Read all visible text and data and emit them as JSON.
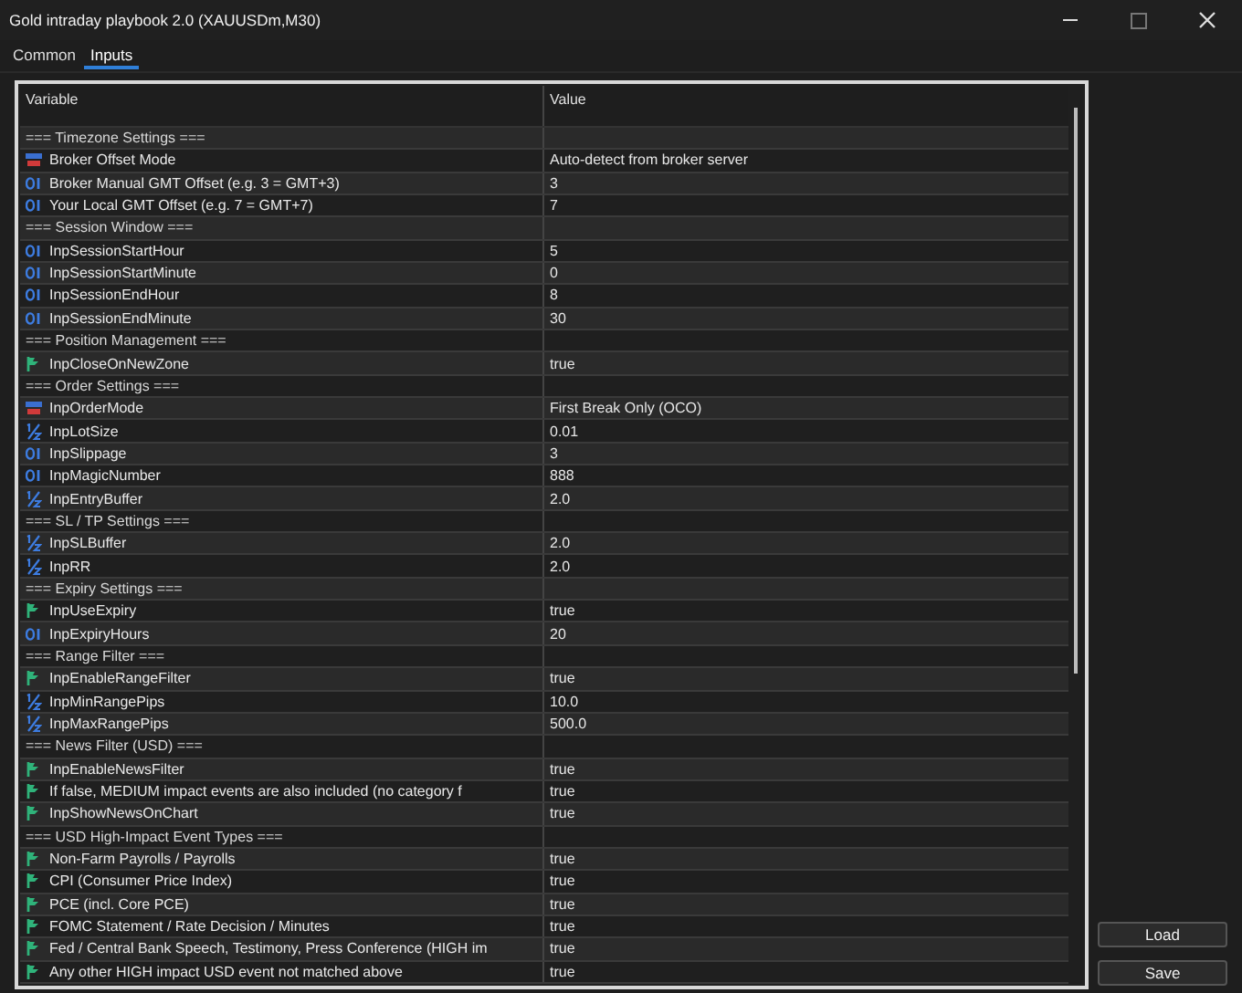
{
  "window": {
    "title": "Gold intraday playbook 2.0 (XAUUSDm,M30)"
  },
  "tabs": [
    {
      "label": "Common",
      "selected": false
    },
    {
      "label": "Inputs",
      "selected": true
    }
  ],
  "table": {
    "columns": [
      "Variable",
      "Value"
    ],
    "rows": [
      {
        "kind": "section",
        "variable": "=== Timezone Settings ==="
      },
      {
        "kind": "enum",
        "variable": "Broker Offset Mode",
        "value": "Auto-detect from broker server"
      },
      {
        "kind": "int",
        "variable": "Broker Manual GMT Offset (e.g. 3 = GMT+3)",
        "value": "3"
      },
      {
        "kind": "int",
        "variable": "Your Local GMT Offset (e.g. 7 = GMT+7)",
        "value": "7"
      },
      {
        "kind": "section",
        "variable": "=== Session Window ==="
      },
      {
        "kind": "int",
        "variable": "InpSessionStartHour",
        "value": "5"
      },
      {
        "kind": "int",
        "variable": "InpSessionStartMinute",
        "value": "0"
      },
      {
        "kind": "int",
        "variable": "InpSessionEndHour",
        "value": "8"
      },
      {
        "kind": "int",
        "variable": "InpSessionEndMinute",
        "value": "30"
      },
      {
        "kind": "section",
        "variable": "=== Position Management ==="
      },
      {
        "kind": "bool",
        "variable": "InpCloseOnNewZone",
        "value": "true"
      },
      {
        "kind": "section",
        "variable": "=== Order Settings ==="
      },
      {
        "kind": "enum",
        "variable": "InpOrderMode",
        "value": "First Break Only (OCO)"
      },
      {
        "kind": "double",
        "variable": "InpLotSize",
        "value": "0.01"
      },
      {
        "kind": "int",
        "variable": "InpSlippage",
        "value": "3"
      },
      {
        "kind": "int",
        "variable": "InpMagicNumber",
        "value": "888"
      },
      {
        "kind": "double",
        "variable": "InpEntryBuffer",
        "value": "2.0"
      },
      {
        "kind": "section",
        "variable": "=== SL / TP Settings ==="
      },
      {
        "kind": "double",
        "variable": "InpSLBuffer",
        "value": "2.0"
      },
      {
        "kind": "double",
        "variable": "InpRR",
        "value": "2.0"
      },
      {
        "kind": "section",
        "variable": "=== Expiry Settings ==="
      },
      {
        "kind": "bool",
        "variable": "InpUseExpiry",
        "value": "true"
      },
      {
        "kind": "int",
        "variable": "InpExpiryHours",
        "value": "20"
      },
      {
        "kind": "section",
        "variable": "=== Range Filter ==="
      },
      {
        "kind": "bool",
        "variable": "InpEnableRangeFilter",
        "value": "true"
      },
      {
        "kind": "double",
        "variable": "InpMinRangePips",
        "value": "10.0"
      },
      {
        "kind": "double",
        "variable": "InpMaxRangePips",
        "value": "500.0"
      },
      {
        "kind": "section",
        "variable": "=== News Filter (USD) ==="
      },
      {
        "kind": "bool",
        "variable": "InpEnableNewsFilter",
        "value": "true"
      },
      {
        "kind": "bool",
        "variable": "If false, MEDIUM impact events are also included (no category f",
        "value": "true"
      },
      {
        "kind": "bool",
        "variable": "InpShowNewsOnChart",
        "value": "true"
      },
      {
        "kind": "section",
        "variable": "=== USD High-Impact Event Types ==="
      },
      {
        "kind": "bool",
        "variable": "Non-Farm Payrolls / Payrolls",
        "value": "true"
      },
      {
        "kind": "bool",
        "variable": "CPI (Consumer Price Index)",
        "value": "true"
      },
      {
        "kind": "bool",
        "variable": "PCE (incl. Core PCE)",
        "value": "true"
      },
      {
        "kind": "bool",
        "variable": "FOMC Statement / Rate Decision / Minutes",
        "value": "true"
      },
      {
        "kind": "bool",
        "variable": "Fed / Central Bank Speech, Testimony, Press Conference (HIGH im",
        "value": "true"
      },
      {
        "kind": "bool",
        "variable": "Any other HIGH impact USD event not matched above",
        "value": "true"
      }
    ]
  },
  "buttons": [
    "Load",
    "Save"
  ]
}
